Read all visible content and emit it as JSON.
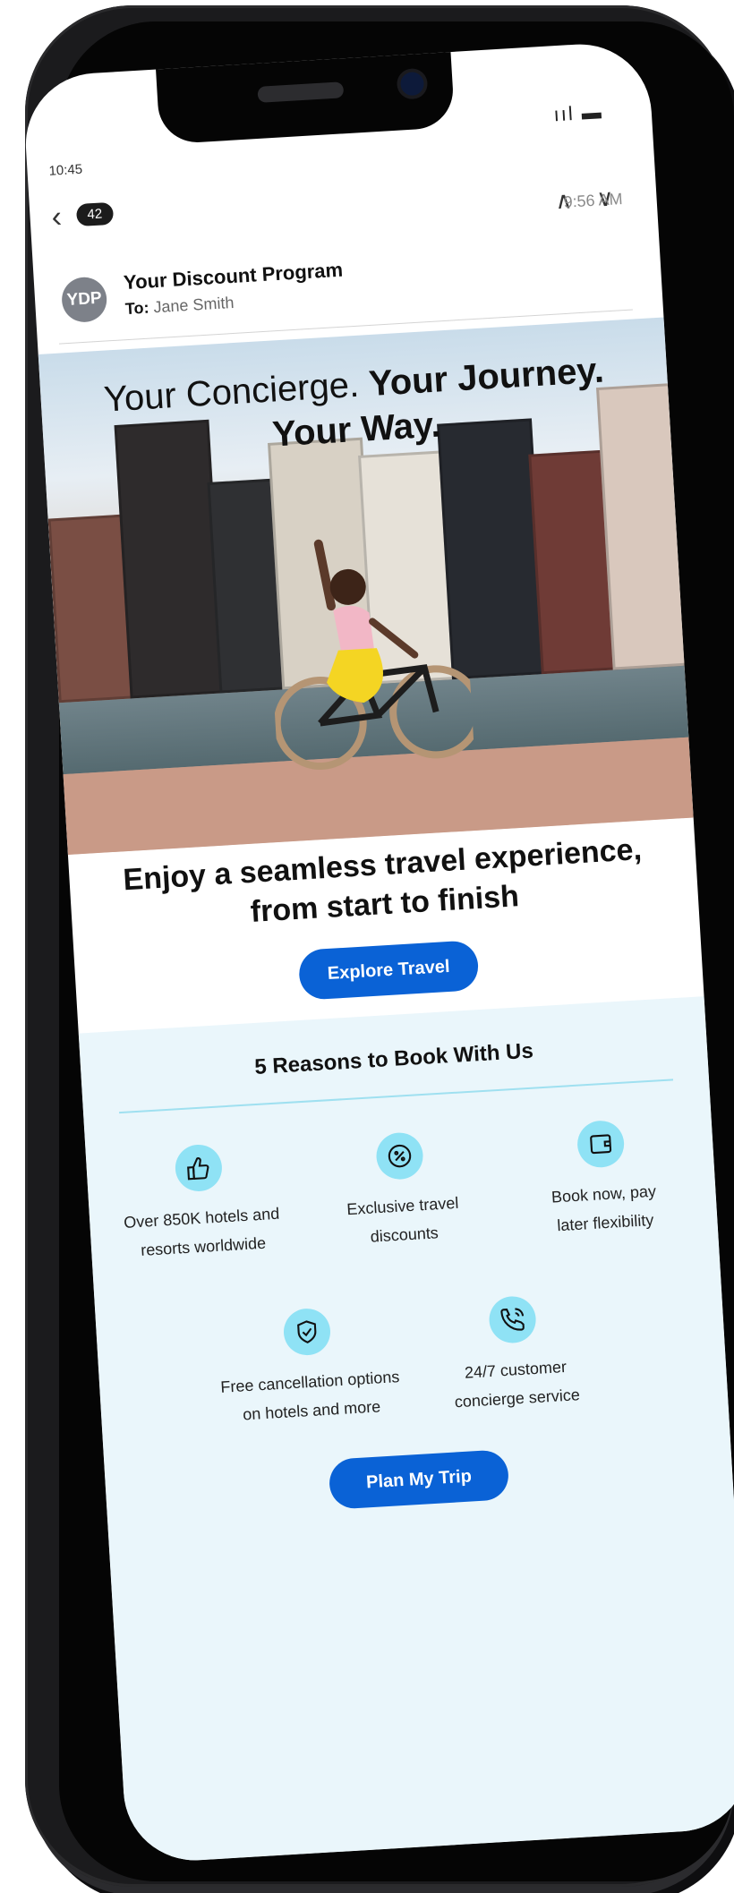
{
  "status": {
    "time": "10:45",
    "icons": "..ıl ▬"
  },
  "mail": {
    "back_badge": "42",
    "time": "9:56 AM",
    "avatar": "YDP",
    "sender": "Your Discount Program",
    "to_label": "To:",
    "to_name": "Jane Smith"
  },
  "hero": {
    "title_light": "Your Concierge.",
    "title_bold_1": "Your Journey.",
    "title_bold_2": "Your Way."
  },
  "body": {
    "headline_1": "Enjoy a seamless travel experience,",
    "headline_2": "from start to finish",
    "cta": "Explore Travel"
  },
  "reasons": {
    "title": "5 Reasons to Book With Us",
    "items": [
      {
        "icon": "thumbs-up-icon",
        "line1": "Over 850K hotels and",
        "line2": "resorts worldwide"
      },
      {
        "icon": "percent-icon",
        "line1": "Exclusive travel",
        "line2": "discounts"
      },
      {
        "icon": "wallet-icon",
        "line1": "Book now, pay",
        "line2": "later flexibility"
      },
      {
        "icon": "shield-check-icon",
        "line1": "Free cancellation options",
        "line2": "on hotels and more"
      },
      {
        "icon": "phone-icon",
        "line1": "24/7 customer",
        "line2": "concierge service"
      }
    ],
    "cta": "Plan My Trip"
  },
  "colors": {
    "accent": "#0a62d6",
    "icon_bg": "#8fe2f5",
    "reasons_bg": "#eaf6fb"
  }
}
